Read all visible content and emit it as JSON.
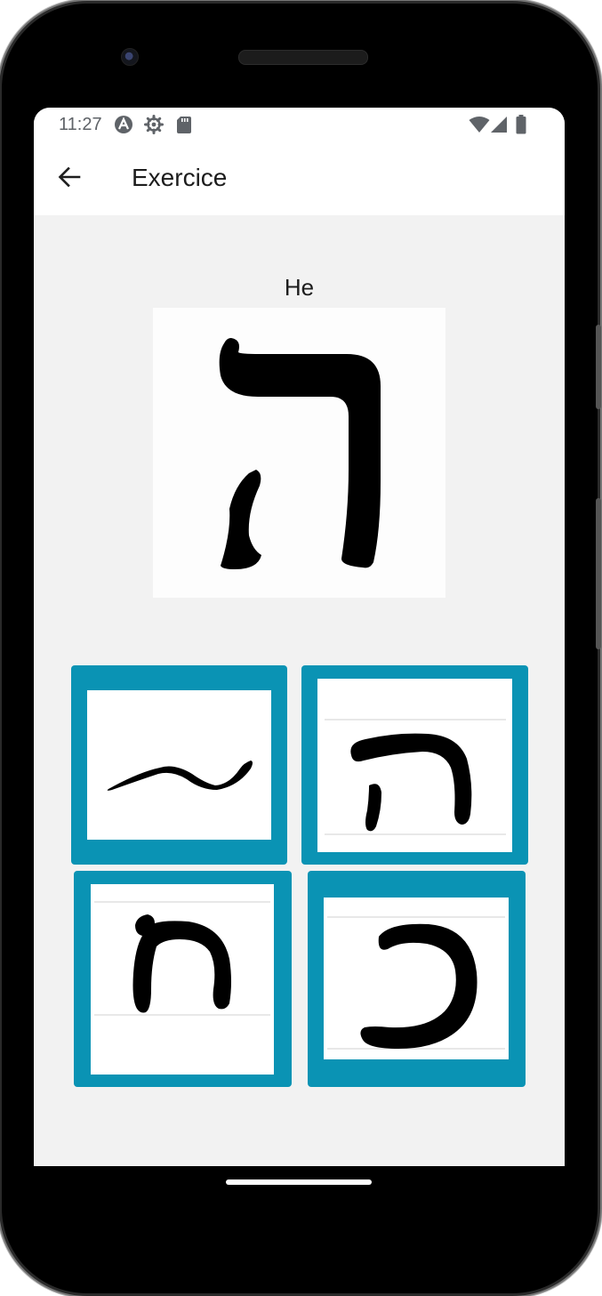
{
  "status_bar": {
    "time": "11:27",
    "left_icons": [
      "app-a-icon",
      "settings-icon",
      "sd-card-icon"
    ],
    "right_icons": [
      "wifi-icon",
      "signal-icon",
      "battery-icon"
    ]
  },
  "header": {
    "title": "Exercice",
    "back_icon": "arrow-back-icon"
  },
  "exercise": {
    "letter_name": "He",
    "letter_glyph": "ה",
    "choices": [
      {
        "glyph": "~",
        "description": "handwritten wave stroke"
      },
      {
        "glyph": "ה",
        "description": "handwritten He"
      },
      {
        "glyph": "ח",
        "description": "handwritten Het"
      },
      {
        "glyph": "כ",
        "description": "handwritten Kaf"
      }
    ]
  },
  "colors": {
    "accent": "#0a93b4",
    "screen_background": "#f2f2f2",
    "header_background": "#ffffff",
    "text": "#1d1d1d"
  }
}
